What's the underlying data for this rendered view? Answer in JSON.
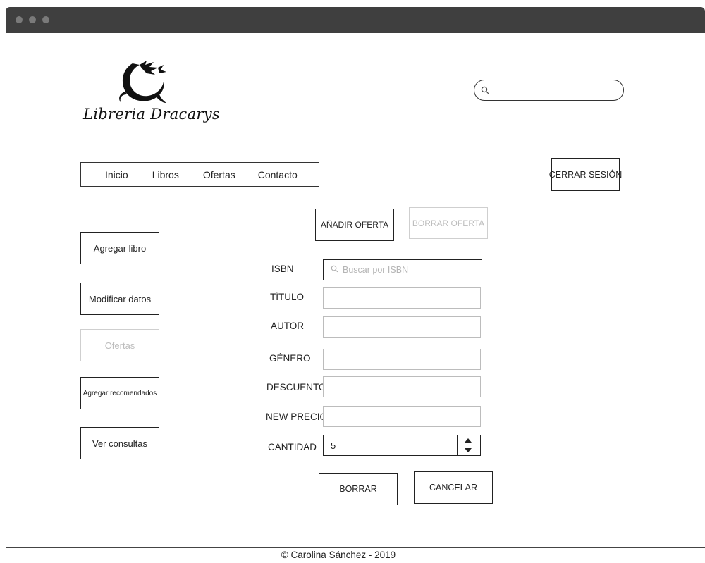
{
  "brand": {
    "logo_text": "Libreria Dracarys",
    "logo_icon": "dragon-icon"
  },
  "search": {
    "placeholder": ""
  },
  "nav": {
    "items": [
      "Inicio",
      "Libros",
      "Ofertas",
      "Contacto"
    ]
  },
  "header": {
    "logout_label": "CERRAR SESIÓN"
  },
  "offers": {
    "add_label": "AÑADIR OFERTA",
    "delete_label": "BORRAR OFERTA"
  },
  "sidebar": {
    "items": [
      {
        "label": "Agregar libro",
        "disabled": false
      },
      {
        "label": "Modificar datos",
        "disabled": false
      },
      {
        "label": "Ofertas",
        "disabled": true
      },
      {
        "label": "Agregar recomendados",
        "disabled": false
      },
      {
        "label": "Ver consultas",
        "disabled": false
      }
    ]
  },
  "form": {
    "isbn_label": "ISBN",
    "isbn_placeholder": "Buscar por ISBN",
    "title_label": "TÍTULO",
    "author_label": "AUTOR",
    "genre_label": "GÉNERO",
    "discount_label": "DESCUENTO",
    "new_price_label": "NEW PRECIO",
    "quantity_label": "CANTIDAD",
    "quantity_value": "5"
  },
  "actions": {
    "clear_label": "BORRAR",
    "cancel_label": "CANCELAR"
  },
  "footer": {
    "text": "© Carolina Sánchez - 2019"
  },
  "colors": {
    "titlebar": "#3f3f3f",
    "border": "#222222",
    "disabled": "#bdbdbd"
  }
}
